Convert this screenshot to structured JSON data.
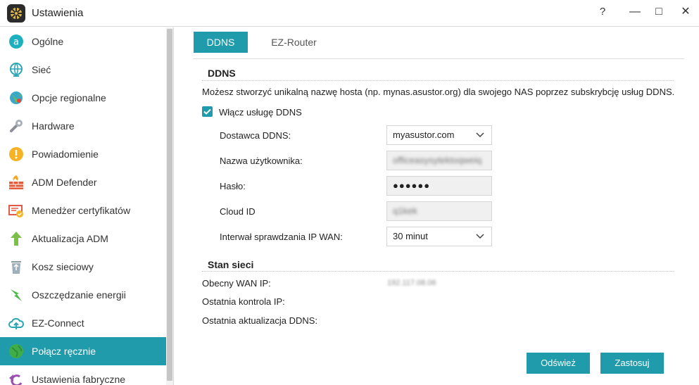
{
  "window": {
    "title": "Ustawienia",
    "controls": {
      "help": "?",
      "minimize": "—",
      "maximize": "□",
      "close": "✕"
    }
  },
  "sidebar": {
    "items": [
      {
        "label": "Ogólne",
        "icon": "general-icon"
      },
      {
        "label": "Sieć",
        "icon": "network-globe-icon"
      },
      {
        "label": "Opcje regionalne",
        "icon": "regional-globe-icon"
      },
      {
        "label": "Hardware",
        "icon": "hardware-wrench-icon"
      },
      {
        "label": "Powiadomienie",
        "icon": "notification-exclamation-icon"
      },
      {
        "label": "ADM Defender",
        "icon": "firewall-icon"
      },
      {
        "label": "Menedżer certyfikatów",
        "icon": "certificate-icon"
      },
      {
        "label": "Aktualizacja ADM",
        "icon": "update-arrow-icon"
      },
      {
        "label": "Kosz sieciowy",
        "icon": "recycle-bin-icon"
      },
      {
        "label": "Oszczędzanie energii",
        "icon": "energy-bolt-icon"
      },
      {
        "label": "EZ-Connect",
        "icon": "cloud-upload-icon"
      },
      {
        "label": "Połącz ręcznie",
        "icon": "manual-connect-globe-icon",
        "active": true
      },
      {
        "label": "Ustawienia fabryczne",
        "icon": "factory-reset-icon"
      }
    ]
  },
  "tabs": [
    {
      "label": "DDNS",
      "active": true
    },
    {
      "label": "EZ-Router",
      "active": false
    }
  ],
  "ddns": {
    "section_title": "DDNS",
    "description": "Możesz stworzyć unikalną nazwę hosta (np. mynas.asustor.org) dla swojego NAS poprzez subskrybcję usług DDNS.",
    "enable_label": "Włącz usługę DDNS",
    "enable_checked": true,
    "fields": {
      "provider": {
        "label": "Dostawca DDNS:",
        "value": "myasustor.com"
      },
      "username": {
        "label": "Nazwa użytkownika:",
        "value": "officeasysytektoqweiq"
      },
      "password": {
        "label": "Hasło:",
        "value": "●●●●●●"
      },
      "cloud_id": {
        "label": "Cloud ID",
        "value": "q1kek"
      },
      "interval": {
        "label": "Interwał sprawdzania IP WAN:",
        "value": "30 minut"
      }
    }
  },
  "network_status": {
    "section_title": "Stan sieci",
    "wan_ip": {
      "label": "Obecny WAN IP:",
      "value": "192.117.08.06"
    },
    "last_check": {
      "label": "Ostatnia kontrola IP:",
      "value": ""
    },
    "last_update": {
      "label": "Ostatnia aktualizacja DDNS:",
      "value": ""
    }
  },
  "buttons": {
    "refresh": "Odśwież",
    "apply": "Zastosuj"
  },
  "colors": {
    "accent": "#1f9bab"
  }
}
